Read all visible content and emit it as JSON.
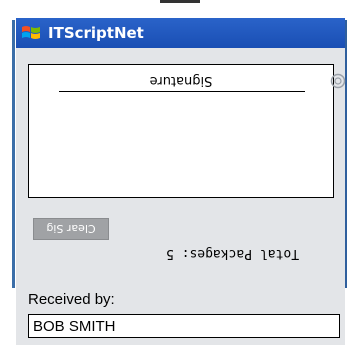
{
  "window": {
    "title": "ITScriptNet",
    "logo_icon": "windows-flag-icon"
  },
  "signature": {
    "label": "Signature"
  },
  "clear_button": {
    "label": "Clear Sig"
  },
  "packages": {
    "total_text": "Total Packages: 5"
  },
  "received": {
    "label": "Received by:",
    "value": "BOB SMITH"
  },
  "colors": {
    "titlebar": "#1f58be",
    "background": "#e3e5e8",
    "button": "#a0a2a5"
  }
}
